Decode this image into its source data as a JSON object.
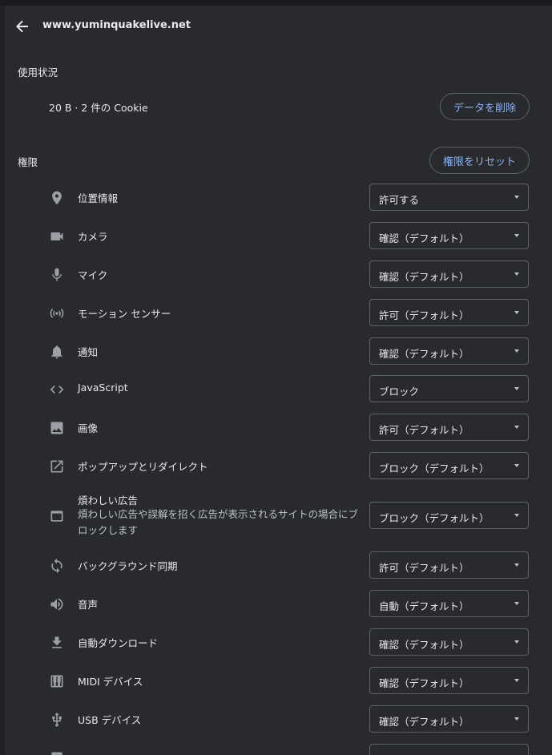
{
  "header": {
    "site": "www.yuminquakelive.net"
  },
  "usage": {
    "label": "使用状況",
    "summary": "20 B · 2 件の Cookie",
    "clear_button": "データを削除"
  },
  "permissions": {
    "label": "権限",
    "reset_button": "権限をリセット",
    "items": [
      {
        "icon": "location-pin-icon",
        "label": "位置情報",
        "value": "許可する"
      },
      {
        "icon": "camera-icon",
        "label": "カメラ",
        "value": "確認（デフォルト）"
      },
      {
        "icon": "microphone-icon",
        "label": "マイク",
        "value": "確認（デフォルト）"
      },
      {
        "icon": "motion-sensor-icon",
        "label": "モーション センサー",
        "value": "許可（デフォルト）"
      },
      {
        "icon": "bell-icon",
        "label": "通知",
        "value": "確認（デフォルト）"
      },
      {
        "icon": "code-icon",
        "label": "JavaScript",
        "value": "ブロック"
      },
      {
        "icon": "image-icon",
        "label": "画像",
        "value": "許可（デフォルト）"
      },
      {
        "icon": "open-in-new-icon",
        "label": "ポップアップとリダイレクト",
        "value": "ブロック（デフォルト）"
      },
      {
        "icon": "ad-window-icon",
        "label": "煩わしい広告",
        "sub": "煩わしい広告や誤解を招く広告が表示されるサイトの場合にブロックします",
        "value": "ブロック（デフォルト）"
      },
      {
        "icon": "sync-icon",
        "label": "バックグラウンド同期",
        "value": "許可（デフォルト）"
      },
      {
        "icon": "speaker-icon",
        "label": "音声",
        "value": "自動（デフォルト）"
      },
      {
        "icon": "download-icon",
        "label": "自動ダウンロード",
        "value": "確認（デフォルト）"
      },
      {
        "icon": "piano-icon",
        "label": "MIDI デバイス",
        "value": "確認（デフォルト）"
      },
      {
        "icon": "usb-icon",
        "label": "USB デバイス",
        "value": "確認（デフォルト）"
      }
    ]
  }
}
